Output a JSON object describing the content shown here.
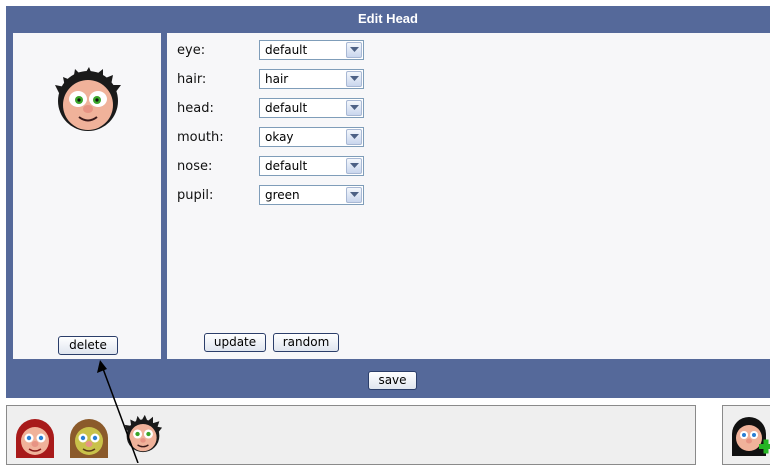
{
  "dialog": {
    "title": "Edit Head",
    "delete_label": "delete",
    "update_label": "update",
    "random_label": "random",
    "save_label": "save"
  },
  "properties": [
    {
      "label": "eye:",
      "value": "default"
    },
    {
      "label": "hair:",
      "value": "hair"
    },
    {
      "label": "head:",
      "value": "default"
    },
    {
      "label": "mouth:",
      "value": "okay"
    },
    {
      "label": "nose:",
      "value": "default"
    },
    {
      "label": "pupil:",
      "value": "green"
    }
  ],
  "tray": {
    "heads": [
      "red-hair-head",
      "brown-hair-head",
      "selected-curly-head"
    ],
    "add_icon": "add-head-icon"
  },
  "colors": {
    "header": "#55699a",
    "pane": "#f7f7f9",
    "skin": "#f0b29a",
    "pupil": "#3aa52a"
  }
}
